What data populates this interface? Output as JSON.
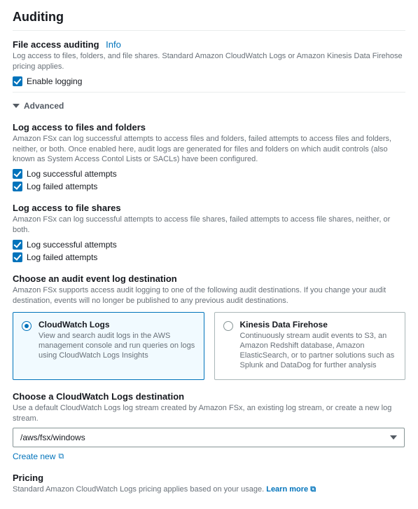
{
  "title": "Auditing",
  "fileAccess": {
    "header": "File access auditing",
    "info": "Info",
    "desc": "Log access to files, folders, and file shares. Standard Amazon CloudWatch Logs or Amazon Kinesis Data Firehose pricing applies.",
    "enableLabel": "Enable logging"
  },
  "advanced": {
    "label": "Advanced"
  },
  "filesFolders": {
    "title": "Log access to files and folders",
    "desc": "Amazon FSx can log successful attempts to access files and folders, failed attempts to access files and folders, neither, or both. Once enabled here, audit logs are generated for files and folders on which audit controls (also known as System Access Contol Lists or SACLs) have been configured.",
    "success": "Log successful attempts",
    "failed": "Log failed attempts"
  },
  "shares": {
    "title": "Log access to file shares",
    "desc": "Amazon FSx can log successful attempts to access file shares, failed attempts to access file shares, neither, or both.",
    "success": "Log successful attempts",
    "failed": "Log failed attempts"
  },
  "destination": {
    "title": "Choose an audit event log destination",
    "desc": "Amazon FSx supports access audit logging to one of the following audit destinations. If you change your audit destination, events will no longer be published to any previous audit destinations.",
    "cw": {
      "title": "CloudWatch Logs",
      "desc": "View and search audit logs in the AWS management console and run queries on logs using CloudWatch Logs Insights"
    },
    "firehose": {
      "title": "Kinesis Data Firehose",
      "desc": "Continuously stream audit events to S3, an Amazon Redshift database, Amazon ElasticSearch, or to partner solutions such as Splunk and DataDog for further analysis"
    }
  },
  "cwDest": {
    "title": "Choose a CloudWatch Logs destination",
    "desc": "Use a default CloudWatch Logs log stream created by Amazon FSx, an existing log stream, or create a new log stream.",
    "value": "/aws/fsx/windows",
    "createNew": "Create new"
  },
  "pricing": {
    "title": "Pricing",
    "desc": "Standard Amazon CloudWatch Logs pricing applies based on your usage.",
    "learn": "Learn more"
  }
}
